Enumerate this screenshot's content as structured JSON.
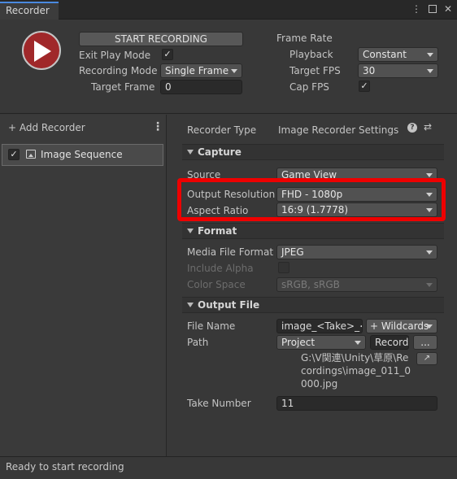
{
  "window": {
    "tab_title": "Recorder",
    "menu_glyph": "⋮",
    "maximize_icon": "maximize-icon",
    "close_glyph": "✕"
  },
  "header": {
    "start_button": "START RECORDING",
    "exit_play_mode_label": "Exit Play Mode",
    "exit_play_mode_checked": true,
    "recording_mode_label": "Recording Mode",
    "recording_mode_value": "Single Frame",
    "target_frame_label": "Target Frame",
    "target_frame_value": "0",
    "frame_rate_heading": "Frame Rate",
    "playback_label": "Playback",
    "playback_value": "Constant",
    "target_fps_label": "Target FPS",
    "target_fps_value": "30",
    "cap_fps_label": "Cap FPS",
    "cap_fps_checked": true
  },
  "left": {
    "add_recorder": "+ Add Recorder",
    "kebab": "⋮",
    "recorders": [
      {
        "name": "Image Sequence",
        "enabled": true
      }
    ]
  },
  "settings": {
    "recorder_type_label": "Recorder Type",
    "recorder_type_value": "Image Recorder Settings",
    "help_glyph": "?",
    "preset_glyph": "⇄",
    "capture": {
      "title": "Capture",
      "source_label": "Source",
      "source_value": "Game View",
      "output_resolution_label": "Output Resolution",
      "output_resolution_value": "FHD - 1080p",
      "aspect_ratio_label": "Aspect Ratio",
      "aspect_ratio_value": "16:9 (1.7778)"
    },
    "format": {
      "title": "Format",
      "media_file_format_label": "Media File Format",
      "media_file_format_value": "JPEG",
      "include_alpha_label": "Include Alpha",
      "color_space_label": "Color Space",
      "color_space_value": "sRGB, sRGB"
    },
    "output_file": {
      "title": "Output File",
      "file_name_label": "File Name",
      "file_name_value": "image_<Take>_<",
      "wildcards_button": "+ Wildcards",
      "path_label": "Path",
      "path_root_value": "Project",
      "path_record_value": "Record",
      "browse_button": "...",
      "resolved_path": "G:\\V関連\\Unity\\草原\\Recordings\\image_011_0000.jpg",
      "take_number_label": "Take Number",
      "take_number_value": "11"
    }
  },
  "status": {
    "text": "Ready to start recording"
  },
  "colors": {
    "highlight_box": "#ee0000",
    "play_button": "#a0282a",
    "tab_accent": "#4a8ae0"
  }
}
